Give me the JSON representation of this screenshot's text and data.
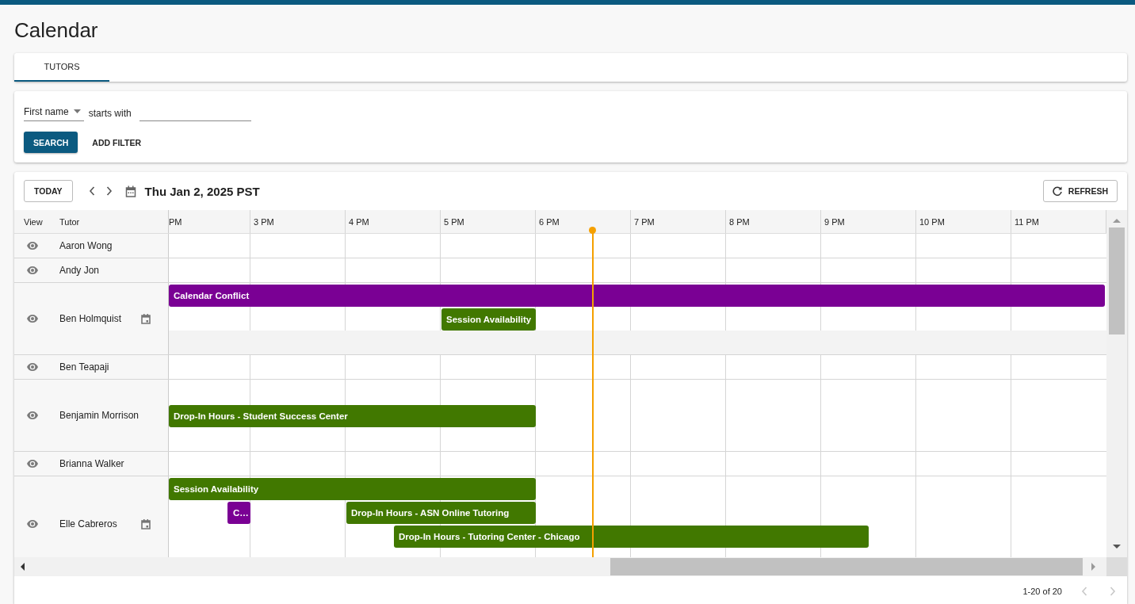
{
  "page_title": "Calendar",
  "tabs": [
    {
      "label": "TUTORS",
      "selected": true
    }
  ],
  "filter": {
    "field": "First name",
    "operator": "starts with",
    "search_button": "SEARCH",
    "add_filter_button": "ADD FILTER"
  },
  "toolbar": {
    "today_button": "TODAY",
    "date": "Thu Jan 2, 2025 PST",
    "refresh_button": "REFRESH"
  },
  "grid": {
    "columns": [
      "View",
      "Tutor"
    ],
    "hours": [
      "PM",
      "3 PM",
      "4 PM",
      "5 PM",
      "6 PM",
      "7 PM",
      "8 PM",
      "9 PM",
      "10 PM",
      "11 PM"
    ],
    "rows": [
      {
        "name": "Aaron Wong",
        "calendar_linked": false
      },
      {
        "name": "Andy Jon",
        "calendar_linked": false
      },
      {
        "name": "Ben Holmquist",
        "calendar_linked": true,
        "events": [
          {
            "title": "Calendar Conflict",
            "color": "#7a0094"
          },
          {
            "title": "Session Availability",
            "color": "#417800"
          }
        ]
      },
      {
        "name": "Ben Teapaji",
        "calendar_linked": false
      },
      {
        "name": "Benjamin Morrison",
        "calendar_linked": false,
        "events": [
          {
            "title": "Drop-In Hours - Student Success Center",
            "color": "#417800"
          }
        ]
      },
      {
        "name": "Brianna Walker",
        "calendar_linked": false
      },
      {
        "name": "Elle Cabreros",
        "calendar_linked": true,
        "events": [
          {
            "title": "Session Availability",
            "color": "#417800"
          },
          {
            "title": "C…",
            "color": "#7a0094"
          },
          {
            "title": "Drop-In Hours - ASN Online Tutoring",
            "color": "#417800"
          },
          {
            "title": "Drop-In Hours - Tutoring Center - Chicago",
            "color": "#417800"
          }
        ]
      }
    ]
  },
  "pagination": {
    "range": "1-20 of 20",
    "previous_disabled": true,
    "next_disabled": true
  }
}
